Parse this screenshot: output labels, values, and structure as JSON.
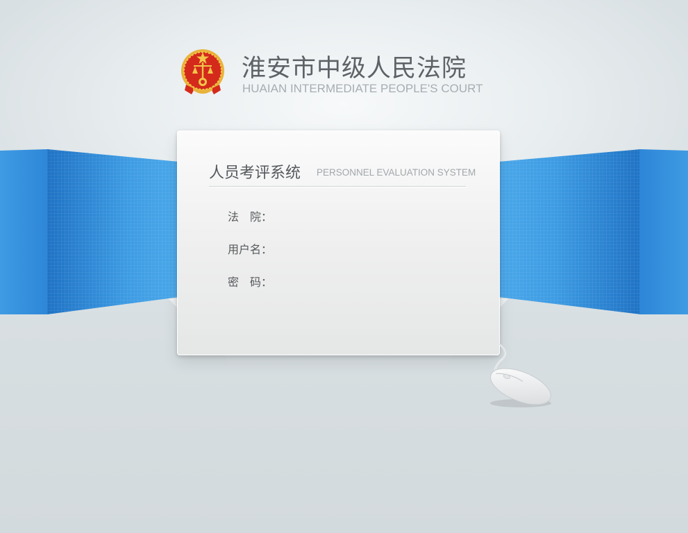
{
  "header": {
    "title": "淮安市中级人民法院",
    "subtitle": "HUAIAN INTERMEDIATE PEOPLE'S COURT"
  },
  "login": {
    "system_title": "人员考评系统",
    "system_subtitle": "PERSONNEL EVALUATION SYSTEM",
    "fields": [
      {
        "label": "法　院：",
        "value": ""
      },
      {
        "label": "用户名：",
        "value": ""
      },
      {
        "label": "密　码：",
        "value": ""
      }
    ]
  },
  "colors": {
    "accent_blue": "#2d86d7",
    "emblem_red": "#d42a1c",
    "emblem_gold": "#f3c64a"
  }
}
